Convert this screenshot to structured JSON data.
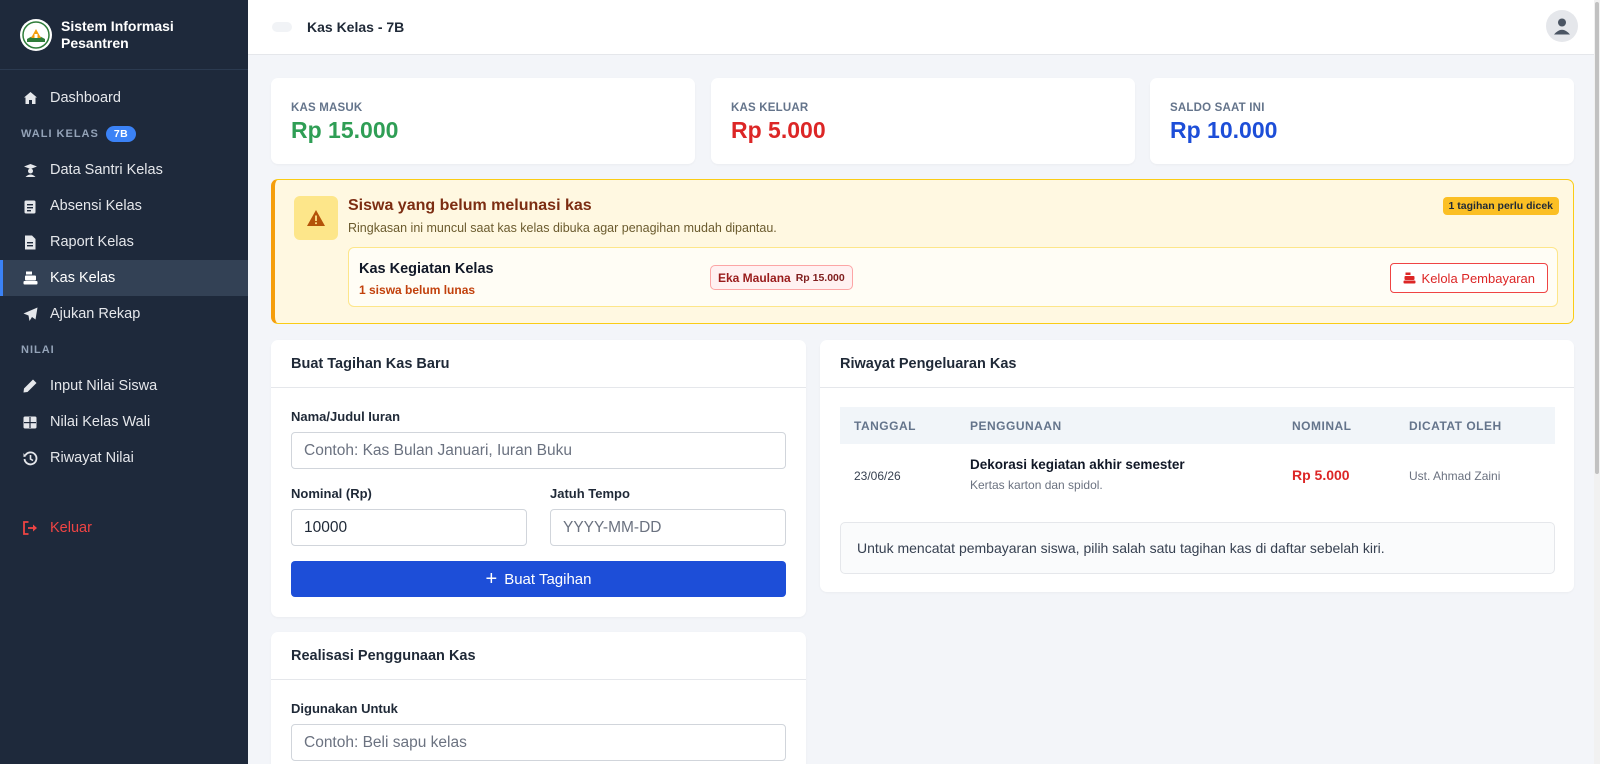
{
  "brand": {
    "name_line1": "Sistem Informasi",
    "name_line2": "Pesantren"
  },
  "nav": {
    "dashboard": "Dashboard",
    "section_wali": "WALI KELAS",
    "section_wali_badge": "7B",
    "data_santri": "Data Santri Kelas",
    "absensi": "Absensi Kelas",
    "raport": "Raport Kelas",
    "kas": "Kas Kelas",
    "ajukan": "Ajukan Rekap",
    "section_nilai": "NILAI",
    "input_nilai": "Input Nilai Siswa",
    "nilai_kelas": "Nilai Kelas Wali",
    "riwayat_nilai": "Riwayat Nilai",
    "keluar": "Keluar"
  },
  "topbar": {
    "title": "Kas Kelas - 7B"
  },
  "stats": {
    "masuk": {
      "label": "KAS MASUK",
      "value": "Rp 15.000",
      "color": "#2f9e55"
    },
    "keluar": {
      "label": "KAS KELUAR",
      "value": "Rp 5.000",
      "color": "#dc2626"
    },
    "saldo": {
      "label": "SALDO SAAT INI",
      "value": "Rp 10.000",
      "color": "#1d4ed8"
    }
  },
  "alert": {
    "title": "Siswa yang belum melunasi kas",
    "desc": "Ringkasan ini muncul saat kas kelas dibuka agar penagihan mudah dipantau.",
    "badge": "1 tagihan perlu dicek",
    "item": {
      "title": "Kas Kegiatan Kelas",
      "sub": "1 siswa belum lunas",
      "student": "Eka Maulana",
      "amount": "Rp 15.000",
      "button": "Kelola Pembayaran"
    }
  },
  "form_tagihan": {
    "title": "Buat Tagihan Kas Baru",
    "nama_label": "Nama/Judul Iuran",
    "nama_placeholder": "Contoh: Kas Bulan Januari, Iuran Buku",
    "nominal_label": "Nominal (Rp)",
    "nominal_value": "10000",
    "jatuh_label": "Jatuh Tempo",
    "jatuh_placeholder": "YYYY-MM-DD",
    "button": "Buat Tagihan"
  },
  "form_realisasi": {
    "title": "Realisasi Penggunaan Kas",
    "untuk_label": "Digunakan Untuk",
    "untuk_placeholder": "Contoh: Beli sapu kelas"
  },
  "riwayat": {
    "title": "Riwayat Pengeluaran Kas",
    "columns": [
      "TANGGAL",
      "PENGGUNAAN",
      "NOMINAL",
      "DICATAT OLEH"
    ],
    "rows": [
      {
        "tanggal": "23/06/26",
        "penggunaan": "Dekorasi kegiatan akhir semester",
        "detail": "Kertas karton dan spidol.",
        "nominal": "Rp 5.000",
        "oleh": "Ust. Ahmad Zaini"
      }
    ],
    "note": "Untuk mencatat pembayaran siswa, pilih salah satu tagihan kas di daftar sebelah kiri."
  }
}
